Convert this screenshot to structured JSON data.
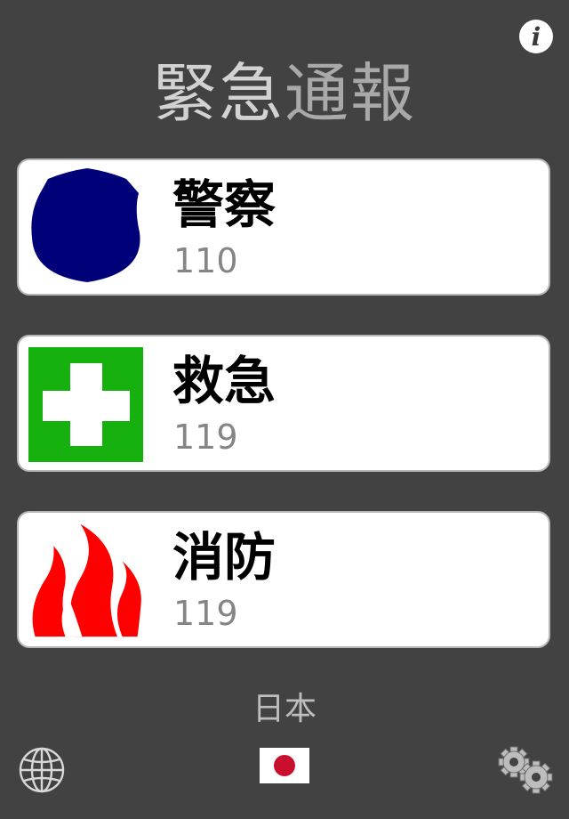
{
  "title": {
    "part1": "緊急",
    "part2": "通報"
  },
  "services": [
    {
      "name": "警察",
      "number": "110",
      "icon": "police-badge-icon"
    },
    {
      "name": "救急",
      "number": "119",
      "icon": "first-aid-cross-icon"
    },
    {
      "name": "消防",
      "number": "119",
      "icon": "fire-flame-icon"
    }
  ],
  "country": "日本",
  "toolbar": {
    "info_icon": "info-icon",
    "globe_icon": "globe-icon",
    "flag_icon": "japan-flag-icon",
    "settings_icon": "gears-icon"
  },
  "colors": {
    "background": "#424242",
    "police": "#000078",
    "first_aid": "#16b10f",
    "fire": "#ff0000",
    "flag_red": "#c8102e"
  }
}
